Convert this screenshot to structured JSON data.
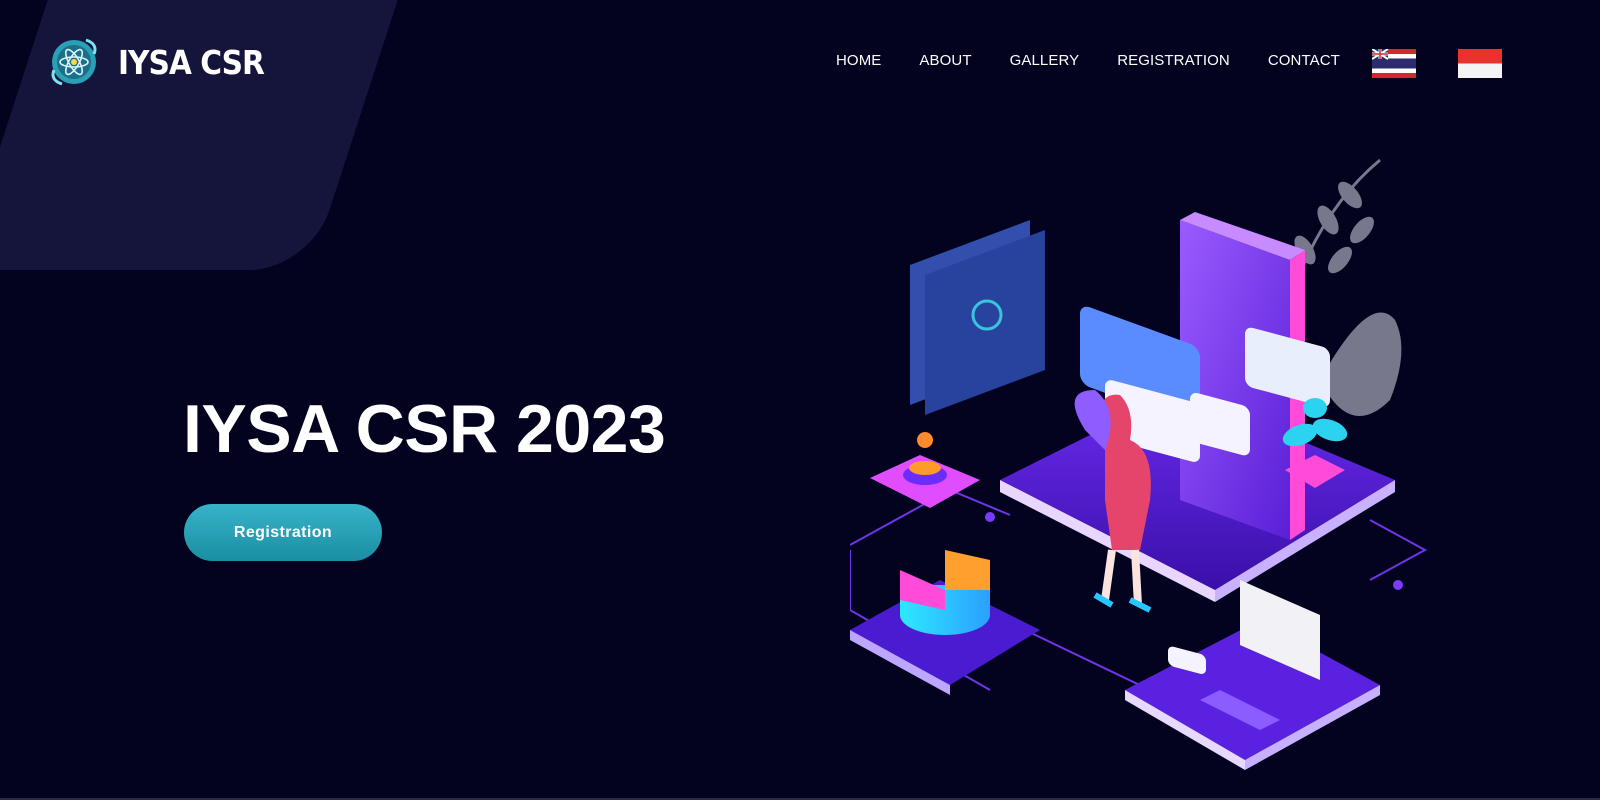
{
  "brand": {
    "name": "IYSA CSR",
    "logo_icon": "atom-globe-icon"
  },
  "nav": {
    "items": [
      "HOME",
      "ABOUT",
      "GALLERY",
      "REGISTRATION",
      "CONTACT"
    ],
    "languages": [
      {
        "icon": "thai-flag-icon"
      },
      {
        "icon": "indonesian-flag-icon"
      }
    ]
  },
  "hero": {
    "title": "IYSA CSR 2023",
    "cta_label": "Registration",
    "illustration_icon": "isometric-mobile-app-illustration"
  },
  "colors": {
    "background": "#03021f",
    "corner_shape": "#15143a",
    "cta_start": "#38b3c8",
    "cta_end": "#1a8ea3",
    "accent_purple": "#7b3bff"
  }
}
